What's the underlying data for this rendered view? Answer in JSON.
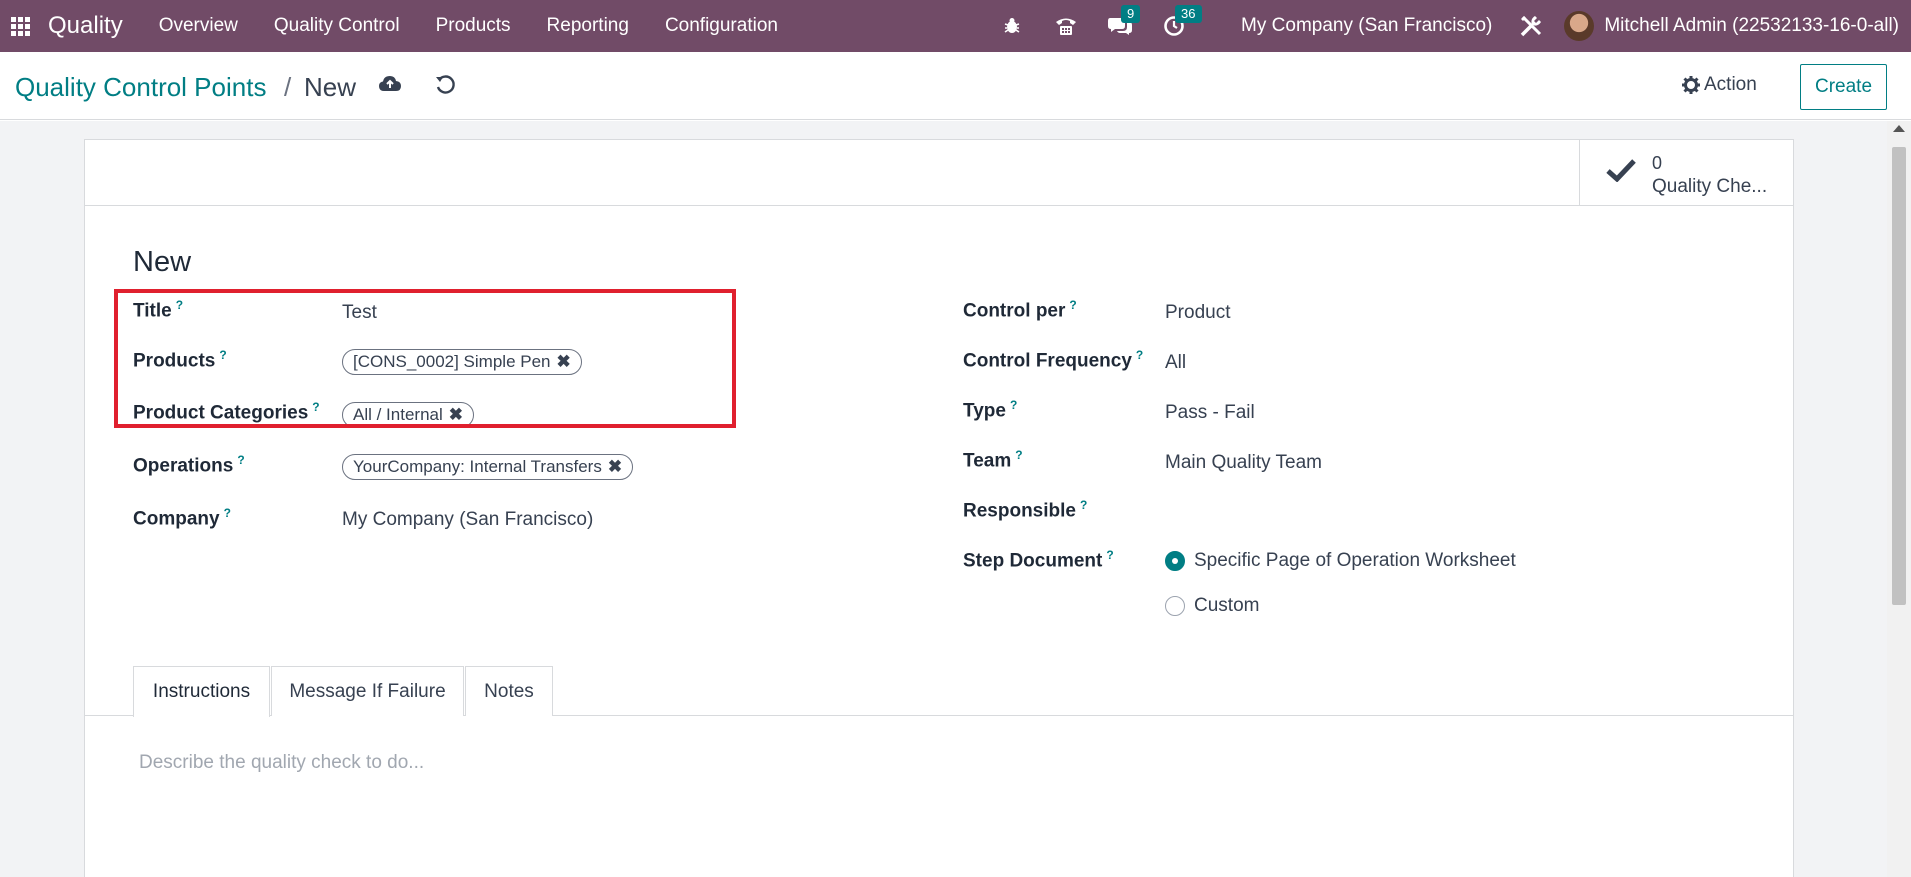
{
  "topnav": {
    "brand": "Quality",
    "menu": [
      "Overview",
      "Quality Control",
      "Products",
      "Reporting",
      "Configuration"
    ],
    "messages_count": "9",
    "activities_count": "36",
    "company": "My Company (San Francisco)",
    "user": "Mitchell Admin (22532133-16-0-all)",
    "bg_color": "#714B67"
  },
  "breadcrumb": {
    "parent": "Quality Control Points",
    "separator": "/",
    "current": "New"
  },
  "toolbar": {
    "action_label": "Action",
    "create_label": "Create"
  },
  "stat_button": {
    "value": "0",
    "label": "Quality Che..."
  },
  "form": {
    "record_title": "New",
    "left": {
      "title_label": "Title",
      "title_value": "Test",
      "products_label": "Products",
      "products_tag": "[CONS_0002] Simple Pen",
      "categories_label": "Product Categories",
      "categories_tag": "All / Internal",
      "operations_label": "Operations",
      "operations_tag": "YourCompany: Internal Transfers",
      "company_label": "Company",
      "company_value": "My Company (San Francisco)"
    },
    "right": {
      "control_per_label": "Control per",
      "control_per_value": "Product",
      "frequency_label": "Control Frequency",
      "frequency_value": "All",
      "type_label": "Type",
      "type_value": "Pass - Fail",
      "team_label": "Team",
      "team_value": "Main Quality Team",
      "responsible_label": "Responsible",
      "step_document_label": "Step Document",
      "step_document_options": [
        "Specific Page of Operation Worksheet",
        "Custom"
      ],
      "step_document_selected": "Specific Page of Operation Worksheet"
    },
    "help_marker": "?"
  },
  "notebook": {
    "tabs": [
      "Instructions",
      "Message If Failure",
      "Notes"
    ],
    "active_tab": "Instructions",
    "placeholder": "Describe the quality check to do..."
  },
  "colors": {
    "accent": "#017E84",
    "highlight": "#e0202e"
  }
}
